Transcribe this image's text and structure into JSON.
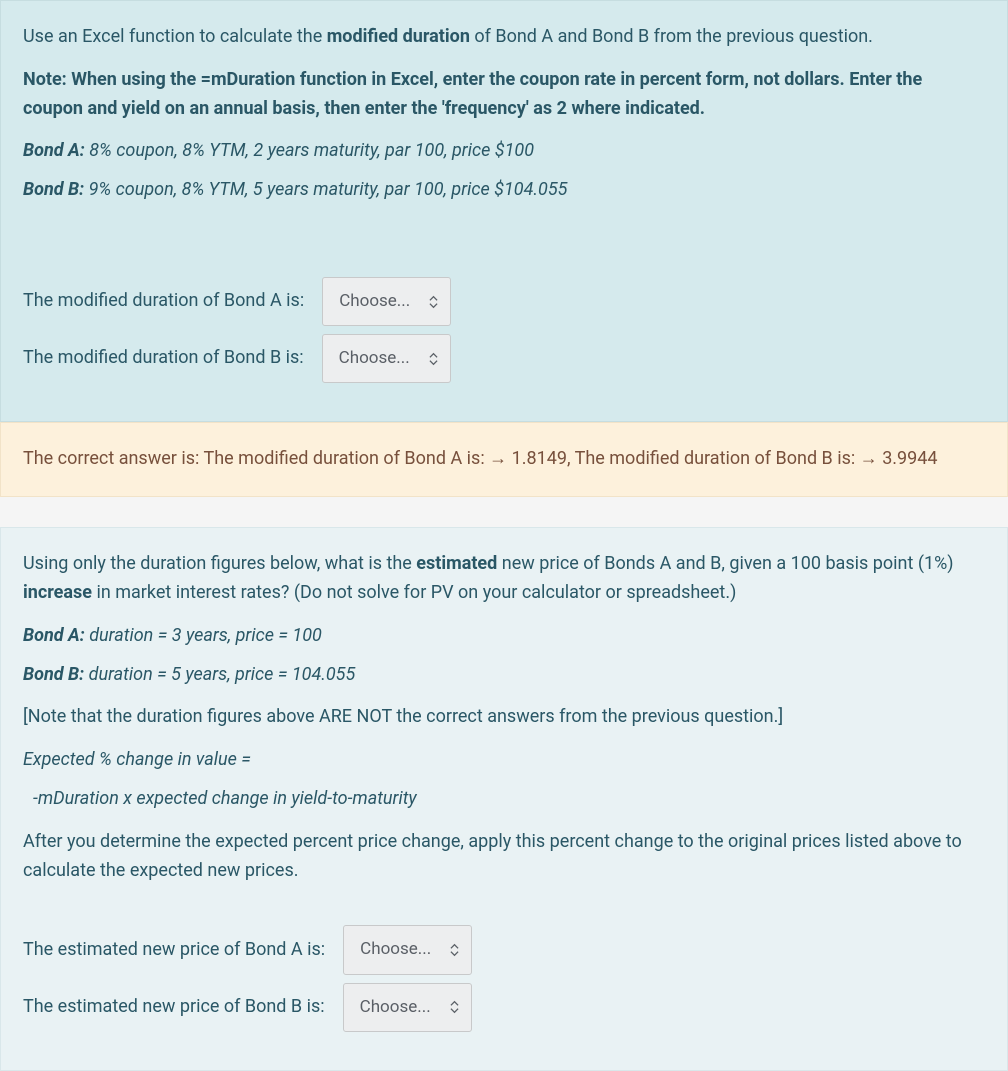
{
  "q1": {
    "intro": {
      "before": "Use an Excel function to calculate the ",
      "bold": "modified duration",
      "after": " of Bond A and Bond B from the previous question."
    },
    "note": "Note: When using the =mDuration function in Excel, enter the coupon rate in percent form, not dollars. Enter the coupon and yield on an annual basis, then enter the 'frequency' as 2 where indicated.",
    "bondA": {
      "label": "Bond A:",
      "text": " 8% coupon, 8% YTM, 2 years maturity, par 100, price $100"
    },
    "bondB": {
      "label": "Bond B:",
      "text": " 9% coupon, 8% YTM, 5 years maturity, par 100, price $104.055"
    },
    "rowA": "The modified duration of Bond A is:",
    "rowB": "The modified duration of Bond B is:",
    "selectA": "Choose...",
    "selectB": "Choose..."
  },
  "feedback": {
    "text": "The correct answer is: The modified duration of Bond A is: → 1.8149, The modified duration of Bond B is: → 3.9944"
  },
  "q2": {
    "intro": {
      "p1a": "Using only the duration figures below, what is the ",
      "p1b": "estimated",
      "p1c": " new price of Bonds A and B, given a 100 basis point (1%) ",
      "p1d": "increase",
      "p1e": " in market interest rates? (Do not solve for PV on your calculator or spreadsheet.)"
    },
    "bondA": {
      "label": "Bond A:",
      "text": " duration = 3 years, price = 100"
    },
    "bondB": {
      "label": "Bond B:",
      "text": " duration = 5 years, price = 104.055"
    },
    "note": "[Note that the duration figures above ARE NOT the correct answers from the previous question.]",
    "formulaLine1": "Expected % change in value =",
    "formulaLine2": "-mDuration x expected change in yield-to-maturity",
    "after": "After you determine the expected percent price change, apply this percent change to the original prices listed above to calculate the expected new prices.",
    "rowA": "The estimated new price of Bond A is:",
    "rowB": "The estimated new price of Bond B is:",
    "selectA": "Choose...",
    "selectB": "Choose..."
  }
}
